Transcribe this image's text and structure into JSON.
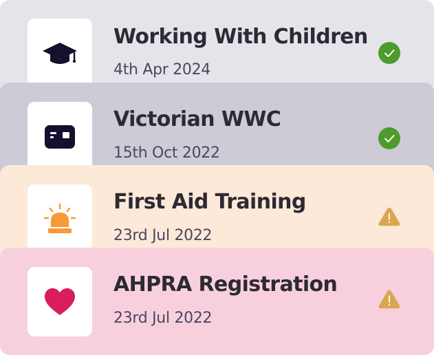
{
  "credentials": [
    {
      "title": "Working With Children",
      "date": "4th Apr 2024",
      "icon": "graduation-cap-icon",
      "status": "valid",
      "status_icon": "check-circle-icon",
      "bg": "#e5e4ea"
    },
    {
      "title": "Victorian WWC",
      "date": "15th Oct 2022",
      "icon": "id-card-icon",
      "status": "valid",
      "status_icon": "check-circle-icon",
      "bg": "#cecbd7"
    },
    {
      "title": "First Aid Training",
      "date": "23rd Jul 2022",
      "icon": "siren-icon",
      "status": "warning",
      "status_icon": "warning-triangle-icon",
      "bg": "#fde9d8"
    },
    {
      "title": "AHPRA Registration",
      "date": "23rd Jul 2022",
      "icon": "heart-icon",
      "status": "warning",
      "status_icon": "warning-triangle-icon",
      "bg": "#f8d0dd"
    }
  ],
  "colors": {
    "valid": "#4e9a2c",
    "warning": "#d8a74e",
    "navy": "#14112e",
    "orange": "#f59a35",
    "crimson": "#d81e5b"
  }
}
